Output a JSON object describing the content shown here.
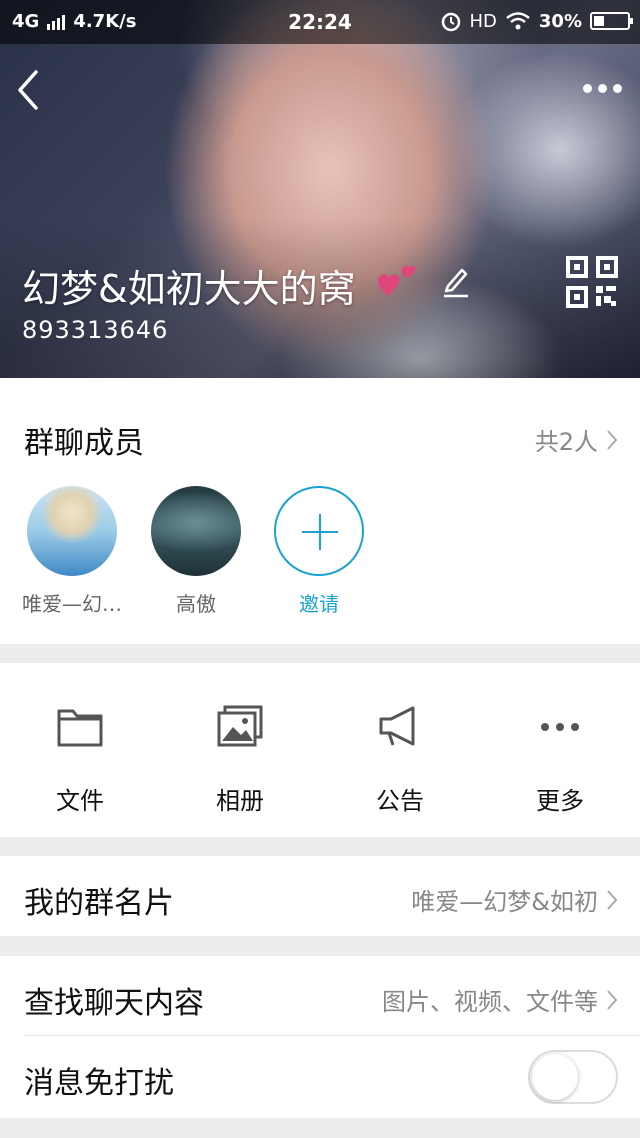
{
  "status_bar": {
    "network": "4G",
    "speed": "4.7K/s",
    "time": "22:24",
    "hd": "HD",
    "battery": "30%",
    "battery_level": 0.3
  },
  "header": {
    "group_name": "幻梦&如初大大的窝",
    "group_id": "893313646"
  },
  "members": {
    "title": "群聊成员",
    "count": "共2人",
    "list": [
      {
        "name": "唯爱—幻…"
      },
      {
        "name": "高傲"
      }
    ],
    "invite_label": "邀请"
  },
  "actions": [
    {
      "label": "文件",
      "icon": "folder-icon"
    },
    {
      "label": "相册",
      "icon": "album-icon"
    },
    {
      "label": "公告",
      "icon": "megaphone-icon"
    },
    {
      "label": "更多",
      "icon": "more-dots-icon"
    }
  ],
  "settings": {
    "my_card_label": "我的群名片",
    "my_card_value": "唯爱—幻梦&如初",
    "search_label": "查找聊天内容",
    "search_value": "图片、视频、文件等",
    "mute_label": "消息免打扰",
    "mute_on": false
  },
  "colors": {
    "accent": "#1aa3d0"
  }
}
